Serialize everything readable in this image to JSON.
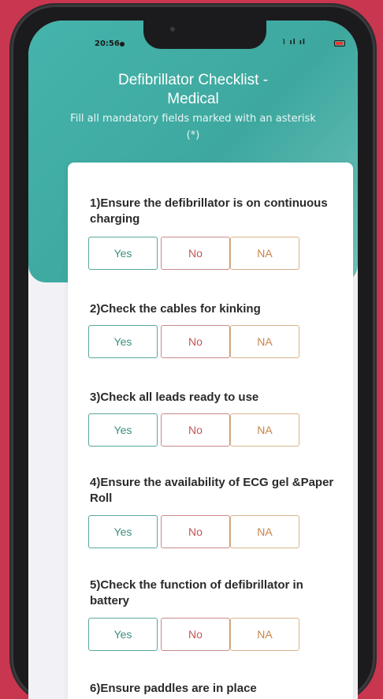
{
  "status_bar": {
    "time": "20:56",
    "signal_text": "⌇ ıl ıl",
    "battery_color": "#e53935"
  },
  "header": {
    "title_line1": "Defibrillator Checklist -",
    "title_line2": "Medical",
    "subtitle": "Fill all mandatory fields marked with an asterisk (*)"
  },
  "colors": {
    "background": "#c8364f",
    "header": "#45b4ab",
    "yes": "#3c8e82",
    "no": "#c25555",
    "na": "#c8844a"
  },
  "options": {
    "yes": "Yes",
    "no": "No",
    "na": "NA"
  },
  "questions": [
    {
      "text": "1)Ensure the defibrillator is on continuous charging"
    },
    {
      "text": "2)Check the cables for kinking"
    },
    {
      "text": "3)Check all leads ready to use"
    },
    {
      "text": "4)Ensure the availability of ECG gel &Paper Roll"
    },
    {
      "text": "5)Check the function of defibrillator in battery"
    },
    {
      "text": "6)Ensure paddles are in place"
    }
  ]
}
